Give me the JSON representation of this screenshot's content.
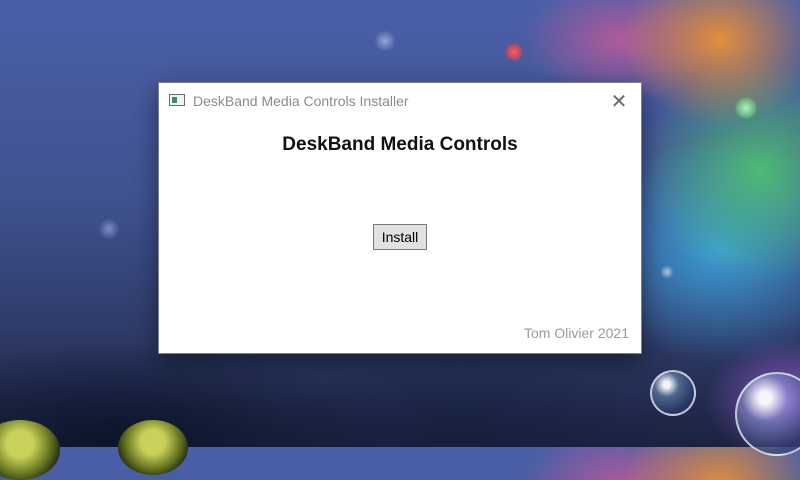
{
  "window": {
    "title": "DeskBand Media Controls Installer",
    "close_glyph": "✕",
    "icon": "app-window-icon"
  },
  "content": {
    "heading": "DeskBand Media Controls",
    "install_label": "Install",
    "credit": "Tom Olivier 2021"
  },
  "colors": {
    "window_bg": "#ffffff",
    "title_text": "#8a8a8a",
    "button_bg": "#e1e1e1",
    "credit_text": "#9a9a9a"
  }
}
